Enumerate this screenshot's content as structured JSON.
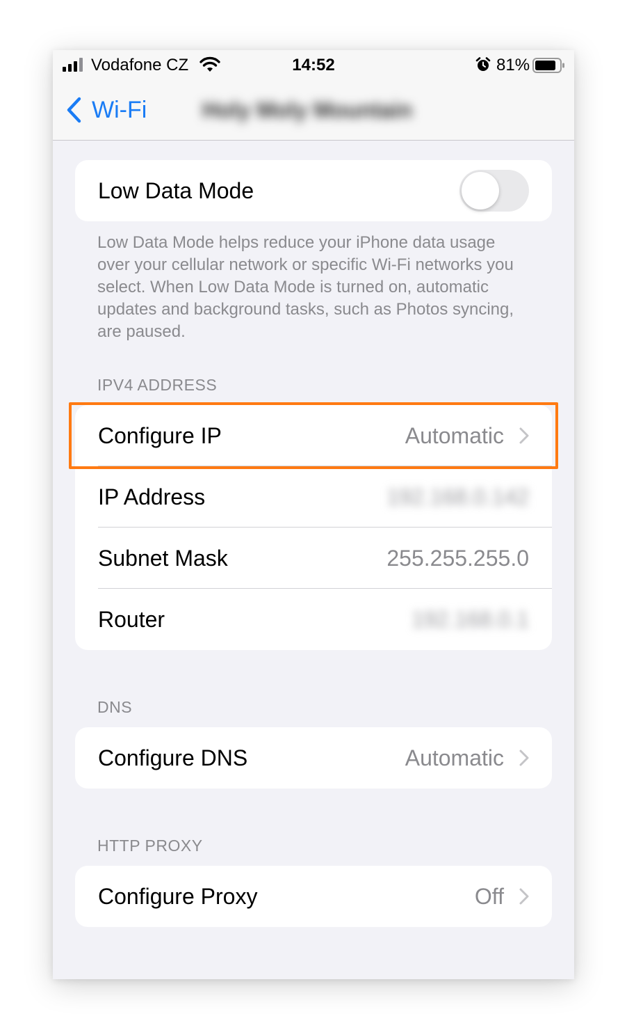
{
  "status_bar": {
    "carrier": "Vodafone CZ",
    "time": "14:52",
    "battery_percent": "81%",
    "battery_level": 0.81,
    "icons": [
      "signal-icon",
      "wifi-icon",
      "alarm-icon",
      "battery-icon"
    ]
  },
  "nav": {
    "back_label": "Wi-Fi",
    "title": "Holy Moly Mountain"
  },
  "low_data": {
    "label": "Low Data Mode",
    "enabled": false,
    "footnote": "Low Data Mode helps reduce your iPhone data usage over your cellular network or specific Wi-Fi networks you select. When Low Data Mode is turned on, automatic updates and background tasks, such as Photos syncing, are paused."
  },
  "ipv4": {
    "header": "IPV4 ADDRESS",
    "configure_ip_label": "Configure IP",
    "configure_ip_value": "Automatic",
    "ip_address_label": "IP Address",
    "ip_address_value": "192.168.0.142",
    "subnet_mask_label": "Subnet Mask",
    "subnet_mask_value": "255.255.255.0",
    "router_label": "Router",
    "router_value": "192.168.0.1"
  },
  "dns": {
    "header": "DNS",
    "configure_dns_label": "Configure DNS",
    "configure_dns_value": "Automatic"
  },
  "proxy": {
    "header": "HTTP PROXY",
    "configure_proxy_label": "Configure Proxy",
    "configure_proxy_value": "Off"
  },
  "colors": {
    "accent": "#1a7cf5",
    "highlight": "#ff7a12",
    "background": "#f2f2f7",
    "secondary_text": "#8a8a8e"
  }
}
